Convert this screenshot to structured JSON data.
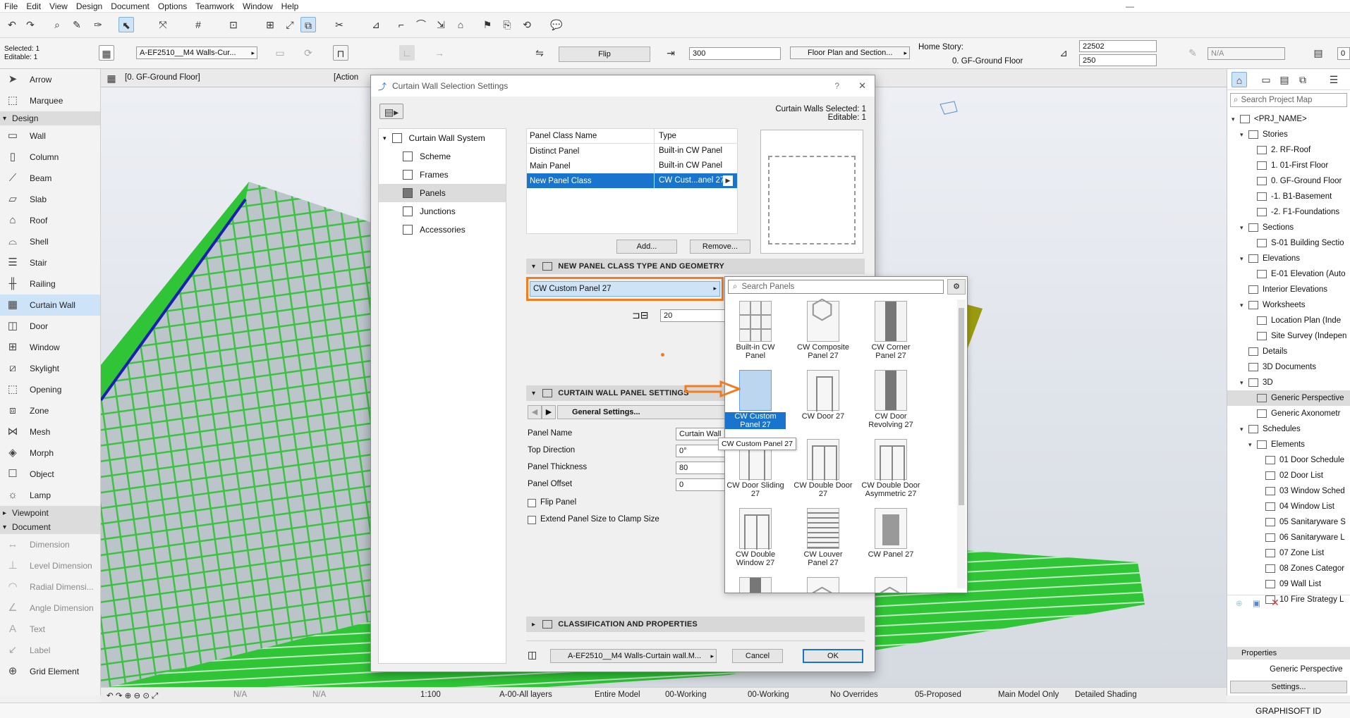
{
  "menu": [
    "File",
    "Edit",
    "View",
    "Design",
    "Document",
    "Options",
    "Teamwork",
    "Window",
    "Help"
  ],
  "infobox": {
    "selected": "Selected: 1",
    "editable": "Editable: 1",
    "layer_value": "A-EF2510__M4 Walls-Cur...",
    "flip_label": "Flip",
    "offset_value": "300",
    "display_value": "Floor Plan and Section...",
    "home_story_label": "Home Story:",
    "home_story_value": "0. GF-Ground Floor",
    "height_top": "22502",
    "height_bottom": "250",
    "na_value": "N/A",
    "cut_value": "0"
  },
  "viewport_tabs": {
    "tab1": "[0. GF-Ground Floor]",
    "tab2": "[Action"
  },
  "toolbox": {
    "items_top": [
      "Arrow",
      "Marquee"
    ],
    "design_header": "Design",
    "design_items": [
      "Wall",
      "Column",
      "Beam",
      "Slab",
      "Roof",
      "Shell",
      "Stair",
      "Railing",
      "Curtain Wall",
      "Door",
      "Window",
      "Skylight",
      "Opening",
      "Zone",
      "Mesh",
      "Morph",
      "Object",
      "Lamp"
    ],
    "viewpoint_header": "Viewpoint",
    "document_header": "Document",
    "document_items": [
      "Dimension",
      "Level Dimension",
      "Radial Dimensi...",
      "Angle Dimension",
      "Text",
      "Label",
      "Grid Element"
    ]
  },
  "dialog": {
    "title": "Curtain Wall Selection Settings",
    "help": "?",
    "close": "✕",
    "selected_info": "Curtain Walls Selected: 1",
    "editable_info": "Editable: 1",
    "tree": {
      "root": "Curtain Wall System",
      "items": [
        "Scheme",
        "Frames",
        "Panels",
        "Junctions",
        "Accessories"
      ]
    },
    "panel_table": {
      "headers": [
        "Panel Class Name",
        "Type"
      ],
      "rows": [
        {
          "name": "Distinct Panel",
          "type": "Built-in CW Panel"
        },
        {
          "name": "Main Panel",
          "type": "Built-in CW Panel"
        },
        {
          "name": "New Panel Class",
          "type": "CW Cust...anel 27"
        }
      ]
    },
    "add_button": "Add...",
    "remove_button": "Remove...",
    "section_geometry": "NEW PANEL CLASS TYPE AND GEOMETRY",
    "panel_type_value": "CW Custom Panel 27",
    "thickness_value": "20",
    "section_settings": "CURTAIN WALL PANEL SETTINGS",
    "general_settings": "General Settings...",
    "fields": [
      {
        "label": "Panel Name",
        "value": "Curtain Wall"
      },
      {
        "label": "Top Direction",
        "value": "0°"
      },
      {
        "label": "Panel Thickness",
        "value": "80"
      },
      {
        "label": "Panel Offset",
        "value": "0"
      }
    ],
    "flip_panel": "Flip Panel",
    "extend_panel": "Extend Panel Size to Clamp Size",
    "section_classification": "CLASSIFICATION AND PROPERTIES",
    "layer_value": "A-EF2510__M4 Walls-Curtain wall.M...",
    "cancel": "Cancel",
    "ok": "OK"
  },
  "picker": {
    "search_placeholder": "Search Panels",
    "items": [
      {
        "label": "Built-in CW Panel"
      },
      {
        "label": "CW Composite Panel 27"
      },
      {
        "label": "CW Corner Panel 27"
      },
      {
        "label": "CW Custom Panel 27"
      },
      {
        "label": "CW Door 27"
      },
      {
        "label": "CW Door Revolving 27"
      },
      {
        "label": "CW Door Sliding 27"
      },
      {
        "label": "CW Double Door 27"
      },
      {
        "label": "CW Double Door Asymmetric 27"
      },
      {
        "label": "CW Double Window 27"
      },
      {
        "label": "CW Louver Panel 27"
      },
      {
        "label": "CW Panel 27"
      }
    ],
    "tooltip": "CW Custom Panel 27"
  },
  "navigator": {
    "search_placeholder": "Search Project Map",
    "rows": [
      {
        "text": "<PRJ_NAME>",
        "indent": 0
      },
      {
        "text": "Stories",
        "indent": 1
      },
      {
        "text": "2. RF-Roof",
        "indent": 2
      },
      {
        "text": "1. 01-First Floor",
        "indent": 2
      },
      {
        "text": "0. GF-Ground Floor",
        "indent": 2
      },
      {
        "text": "-1. B1-Basement",
        "indent": 2
      },
      {
        "text": "-2. F1-Foundations",
        "indent": 2
      },
      {
        "text": "Sections",
        "indent": 1
      },
      {
        "text": "S-01 Building Sectio",
        "indent": 2
      },
      {
        "text": "Elevations",
        "indent": 1
      },
      {
        "text": "E-01 Elevation (Auto",
        "indent": 2
      },
      {
        "text": "Interior Elevations",
        "indent": 1
      },
      {
        "text": "Worksheets",
        "indent": 1
      },
      {
        "text": "Location Plan (Inde",
        "indent": 2
      },
      {
        "text": "Site Survey (Indepen",
        "indent": 2
      },
      {
        "text": "Details",
        "indent": 1
      },
      {
        "text": "3D Documents",
        "indent": 1
      },
      {
        "text": "3D",
        "indent": 1
      },
      {
        "text": "Generic Perspective",
        "indent": 2
      },
      {
        "text": "Generic Axonometr",
        "indent": 2
      },
      {
        "text": "Schedules",
        "indent": 1
      },
      {
        "text": "Elements",
        "indent": 2
      },
      {
        "text": "01 Door Schedule",
        "indent": 3
      },
      {
        "text": "02 Door List",
        "indent": 3
      },
      {
        "text": "03 Window Sched",
        "indent": 3
      },
      {
        "text": "04 Window List",
        "indent": 3
      },
      {
        "text": "05 Sanitaryware S",
        "indent": 3
      },
      {
        "text": "06 Sanitaryware L",
        "indent": 3
      },
      {
        "text": "07 Zone List",
        "indent": 3
      },
      {
        "text": "08 Zones Categor",
        "indent": 3
      },
      {
        "text": "09 Wall List",
        "indent": 3
      },
      {
        "text": "10 Fire Strategy L",
        "indent": 3
      }
    ],
    "properties_header": "Properties",
    "properties_value": "Generic Perspective",
    "settings_button": "Settings..."
  },
  "statusbar": {
    "na1": "N/A",
    "na2": "N/A",
    "scale": "1:100",
    "layers": "A-00-All layers",
    "model": "Entire Model",
    "pen": "00-Working",
    "structure": "00-Working",
    "override": "No Overrides",
    "renovation": "05-Proposed",
    "mvo": "Main Model Only",
    "shading": "Detailed Shading"
  },
  "brand": "GRAPHISOFT ID",
  "colors": {
    "accent": "#1874cd",
    "highlight_orange": "#f07d22",
    "curtain_green": "#2ecc40"
  }
}
